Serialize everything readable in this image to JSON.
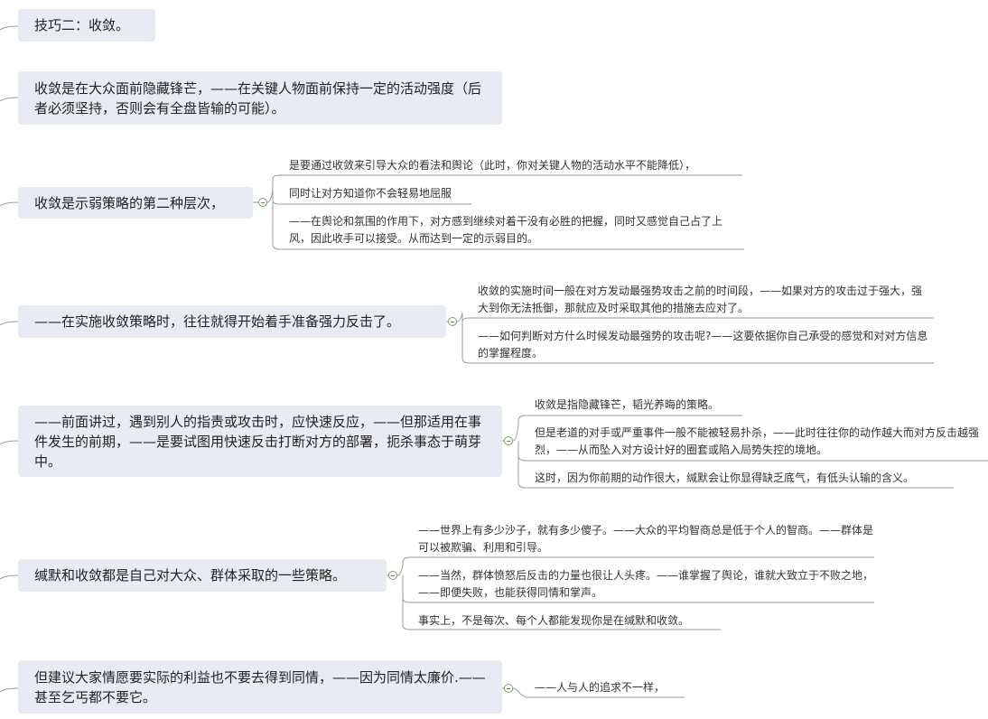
{
  "topics": [
    {
      "text": "技巧二：收敛。",
      "children": []
    },
    {
      "text": "收敛是在大众面前隐藏锋芒，——在关键人物面前保持一定的活动强度（后者必须坚持，否则会有全盘皆输的可能）。",
      "children": []
    },
    {
      "text": "收敛是示弱策略的第二种层次，",
      "children": [
        "是要通过收敛来引导大众的看法和舆论（此时，你对关键人物的活动水平不能降低），",
        "同时让对方知道你不会轻易地屈服",
        "——在舆论和氛围的作用下，对方感到继续对着干没有必胜的把握，同时又感觉自己占了上风，因此收手可以接受。从而达到一定的示弱目的。"
      ]
    },
    {
      "text": "——在实施收敛策略时，往往就得开始着手准备强力反击了。",
      "children": [
        "收敛的实施时间一般在对方发动最强势攻击之前的时间段，——如果对方的攻击过于强大，强大到你无法抵御，那就应及时采取其他的措施去应对了。",
        "——如何判断对方什么时候发动最强势的攻击呢?——这要依据你自己承受的感觉和对对方信息的掌握程度。"
      ]
    },
    {
      "text": "——前面讲过，遇到别人的指责或攻击时，应快速反应，——但那适用在事件发生的前期，——是要试图用快速反击打断对方的部署，扼杀事态于萌芽中。",
      "children": [
        "收敛是指隐藏锋芒，韬光养晦的策略。",
        "但是老道的对手或严重事件一般不能被轻易扑杀，——此时往往你的动作越大而对方反击越强烈，——从而坠入对方设计好的圈套或陷入局势失控的境地。",
        "这时，因为你前期的动作很大，缄默会让你显得缺乏底气，有低头认输的含义。"
      ]
    },
    {
      "text": "缄默和收敛都是自己对大众、群体采取的一些策略。",
      "children": [
        "——世界上有多少沙子，就有多少傻子。——大众的平均智商总是低于个人的智商。——群体是可以被欺骗、利用和引导。",
        "——当然，群体愤怒后反击的力量也很让人头疼。——谁掌握了舆论，谁就大致立于不败之地，——即便失败，也能获得同情和掌声。",
        "事实上，不是每次、每个人都能发现你是在缄默和收敛。"
      ]
    },
    {
      "text": "但建议大家情愿要实际的利益也不要去得到同情，——因为同情太廉价.——甚至乞丐都不要它。",
      "children": [
        "——人与人的追求不一样，"
      ]
    }
  ]
}
